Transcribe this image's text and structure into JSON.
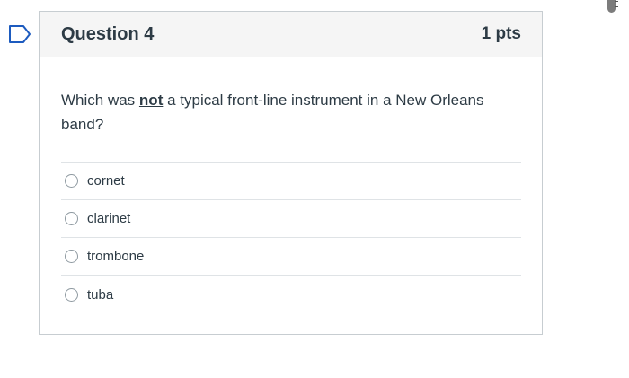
{
  "question": {
    "title": "Question 4",
    "points": "1 pts",
    "text_before": "Which was ",
    "text_emphasis": "not",
    "text_after": " a typical front-line instrument in a New Orleans band?",
    "flag_icon": "bookmark-flag-icon",
    "accent_color": "#1d5bbf"
  },
  "answers": [
    {
      "label": "cornet",
      "selected": false
    },
    {
      "label": "clarinet",
      "selected": false
    },
    {
      "label": "trombone",
      "selected": false
    },
    {
      "label": "tuba",
      "selected": false
    }
  ]
}
